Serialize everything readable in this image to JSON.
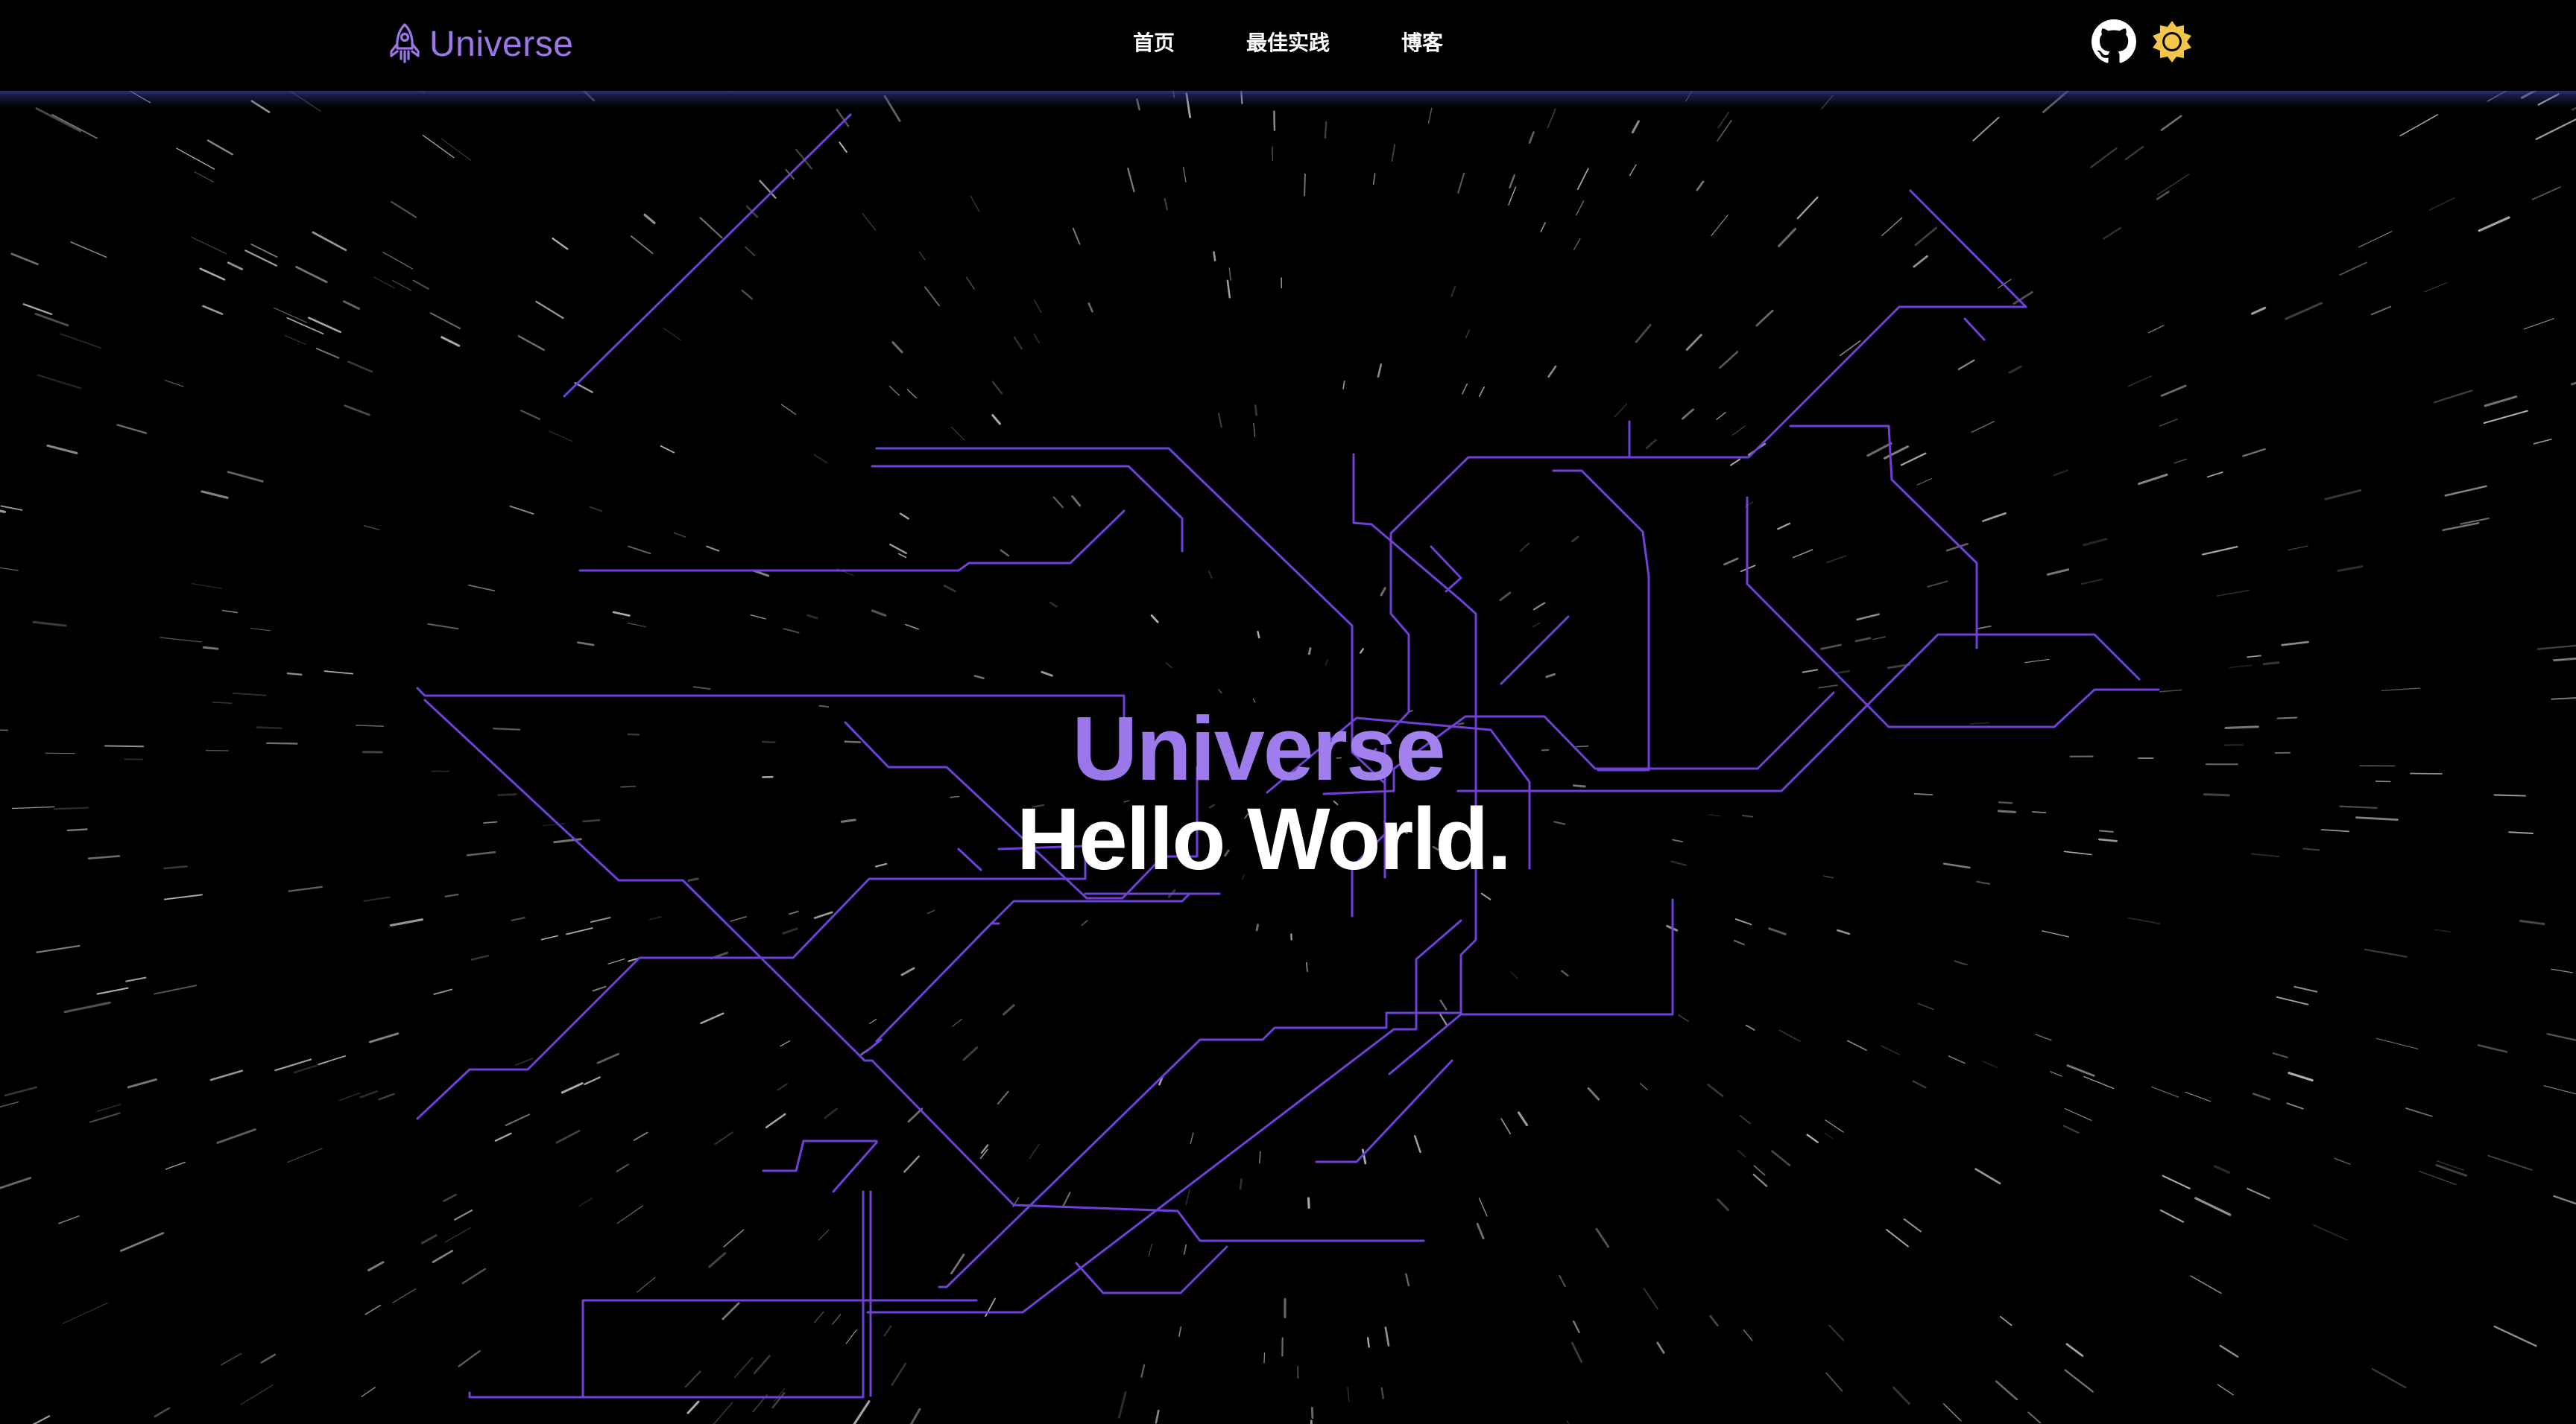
{
  "header": {
    "brand": {
      "name": "Universe",
      "logo_icon": "rocket-icon",
      "color": "#9d77e6"
    },
    "nav": [
      {
        "label": "首页"
      },
      {
        "label": "最佳实践"
      },
      {
        "label": "博客"
      }
    ],
    "actions": [
      {
        "icon": "github-icon"
      },
      {
        "icon": "sun-icon",
        "color": "#f3c54a"
      }
    ]
  },
  "hero": {
    "title": "Universe",
    "subtitle": "Hello World."
  },
  "theme": {
    "background": "#000000",
    "accent": "#7f4fe0",
    "line_color": "#7040d8"
  }
}
